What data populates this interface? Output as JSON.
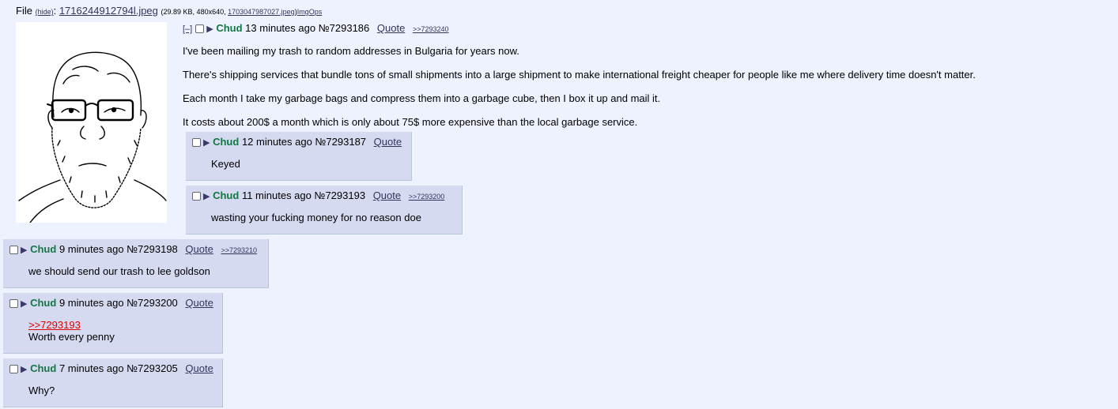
{
  "file": {
    "label": "File",
    "hide": "(hide)",
    "filename": "1716244912794l.jpeg",
    "meta_prefix": "(29.89 KB, 480x640, ",
    "orig_name": "1703047987027.jpeg",
    "meta_suffix": ")",
    "imgops": "ImgOps"
  },
  "op": {
    "hide_button": "[–]",
    "name": "Chud",
    "time": "13 minutes ago",
    "number": "№7293186",
    "quote_label": "Quote",
    "backlinks": [
      ">>7293240"
    ],
    "paragraphs": [
      "I've been mailing my trash to random addresses in Bulgaria for years now.",
      "There's shipping services that bundle tons of small shipments into a large shipment to make international freight cheaper for people like me where delivery time doesn't matter.",
      "Each month I take my garbage bags and compress them into a garbage cube, then I box it up and mail it.",
      "It costs about 200$ a month which is only about 75$ more expensive than the local garbage service."
    ]
  },
  "replies": [
    {
      "name": "Chud",
      "time": "12 minutes ago",
      "number": "№7293187",
      "quote_label": "Quote",
      "backlink": "",
      "quotelink": "",
      "text": "Keyed"
    },
    {
      "name": "Chud",
      "time": "11 minutes ago",
      "number": "№7293193",
      "quote_label": "Quote",
      "backlink": ">>7293200",
      "quotelink": "",
      "text": "wasting your fucking money for no reason doe"
    },
    {
      "name": "Chud",
      "time": "9 minutes ago",
      "number": "№7293198",
      "quote_label": "Quote",
      "backlink": ">>7293210",
      "quotelink": "",
      "text": "we should send our trash to lee goldson"
    },
    {
      "name": "Chud",
      "time": "9 minutes ago",
      "number": "№7293200",
      "quote_label": "Quote",
      "backlink": "",
      "quotelink": ">>7293193",
      "text": "Worth every penny"
    },
    {
      "name": "Chud",
      "time": "7 minutes ago",
      "number": "№7293205",
      "quote_label": "Quote",
      "backlink": "",
      "quotelink": "",
      "text": "Why?"
    }
  ],
  "colors": {
    "background": "#eef2ff",
    "reply_bg": "#d6daf0",
    "name": "#117743",
    "quotelink": "#dd0000"
  }
}
